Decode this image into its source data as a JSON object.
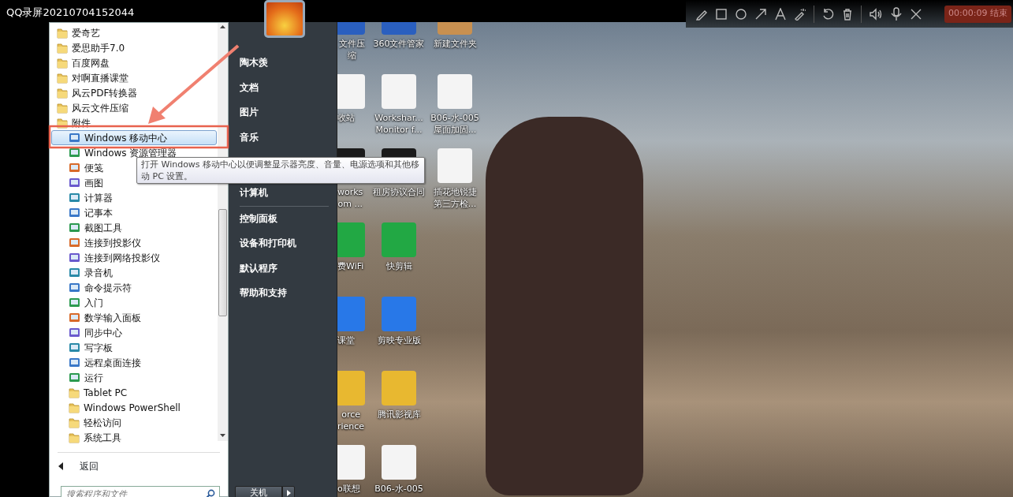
{
  "recorder": {
    "title": "QQ录屏20210704152044",
    "end_button": "00:00:09 结束"
  },
  "start_menu": {
    "programs": [
      {
        "label": "爱奇艺",
        "kind": "folder",
        "selected": false
      },
      {
        "label": "爱思助手7.0",
        "kind": "folder",
        "selected": false
      },
      {
        "label": "百度网盘",
        "kind": "folder",
        "selected": false
      },
      {
        "label": "对啊直播课堂",
        "kind": "folder",
        "selected": false
      },
      {
        "label": "风云PDF转换器",
        "kind": "folder",
        "selected": false
      },
      {
        "label": "风云文件压缩",
        "kind": "folder",
        "selected": false
      },
      {
        "label": "附件",
        "kind": "folder",
        "selected": false,
        "children": [
          {
            "label": "Windows 移动中心",
            "kind": "app",
            "selected": true
          },
          {
            "label": "Windows 资源管理器",
            "kind": "app",
            "selected": false
          },
          {
            "label": "便笺",
            "kind": "app",
            "selected": false
          },
          {
            "label": "画图",
            "kind": "app",
            "selected": false
          },
          {
            "label": "计算器",
            "kind": "app",
            "selected": false
          },
          {
            "label": "记事本",
            "kind": "app",
            "selected": false
          },
          {
            "label": "截图工具",
            "kind": "app",
            "selected": false
          },
          {
            "label": "连接到投影仪",
            "kind": "app",
            "selected": false
          },
          {
            "label": "连接到网络投影仪",
            "kind": "app",
            "selected": false
          },
          {
            "label": "录音机",
            "kind": "app",
            "selected": false
          },
          {
            "label": "命令提示符",
            "kind": "app",
            "selected": false
          },
          {
            "label": "入门",
            "kind": "app",
            "selected": false
          },
          {
            "label": "数学输入面板",
            "kind": "app",
            "selected": false
          },
          {
            "label": "同步中心",
            "kind": "app",
            "selected": false
          },
          {
            "label": "写字板",
            "kind": "app",
            "selected": false
          },
          {
            "label": "远程桌面连接",
            "kind": "app",
            "selected": false
          },
          {
            "label": "运行",
            "kind": "app",
            "selected": false
          },
          {
            "label": "Tablet PC",
            "kind": "folder",
            "selected": false
          },
          {
            "label": "Windows PowerShell",
            "kind": "folder",
            "selected": false
          },
          {
            "label": "轻松访问",
            "kind": "folder",
            "selected": false
          },
          {
            "label": "系统工具",
            "kind": "folder",
            "selected": false
          }
        ]
      }
    ],
    "back": "返回",
    "search": {
      "placeholder": "搜索程序和文件"
    },
    "tooltip": "打开 Windows 移动中心以便调整显示器亮度、音量、电源选项和其他移动 PC 设置。",
    "place_groups": [
      [
        "陶木羡",
        "文档",
        "图片",
        "音乐"
      ],
      [
        "计算机"
      ],
      [
        "控制面板",
        "设备和打印机",
        "默认程序",
        "帮助和支持"
      ]
    ],
    "shutdown": "关机"
  },
  "desktop": {
    "columns": [
      [
        "文件压缩",
        "收站",
        "works\nom ...",
        "费WiFi",
        "课堂",
        "orce\nrience",
        "o联想"
      ],
      [
        "360文件管家",
        "Workshar...\nMonitor f...",
        "租房协议合同",
        "快剪辑",
        "剪映专业版",
        "腾讯影视库",
        "B06-水-005"
      ],
      [
        "新建文件夹",
        "B06-水-005\n屋面加固...",
        "插花地锐捷第三方检..."
      ]
    ]
  }
}
